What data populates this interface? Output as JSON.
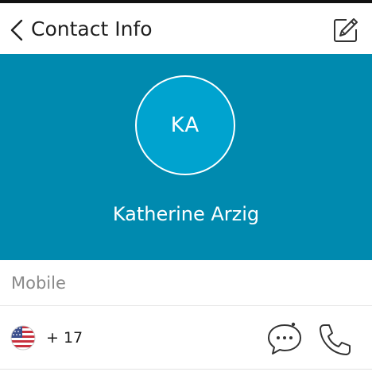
{
  "header": {
    "title": "Contact Info",
    "back_icon": "chevron-left-icon",
    "edit_icon": "edit-pencil-icon"
  },
  "contact": {
    "initials": "KA",
    "name": "Katherine Arzig",
    "hero_color": "#008aaf",
    "avatar_color": "#00a3cf"
  },
  "phone": {
    "section_label": "Mobile",
    "country_flag_icon": "us-flag-icon",
    "number": "+ 17",
    "message_icon": "chat-bubble-icon",
    "call_icon": "phone-icon"
  }
}
